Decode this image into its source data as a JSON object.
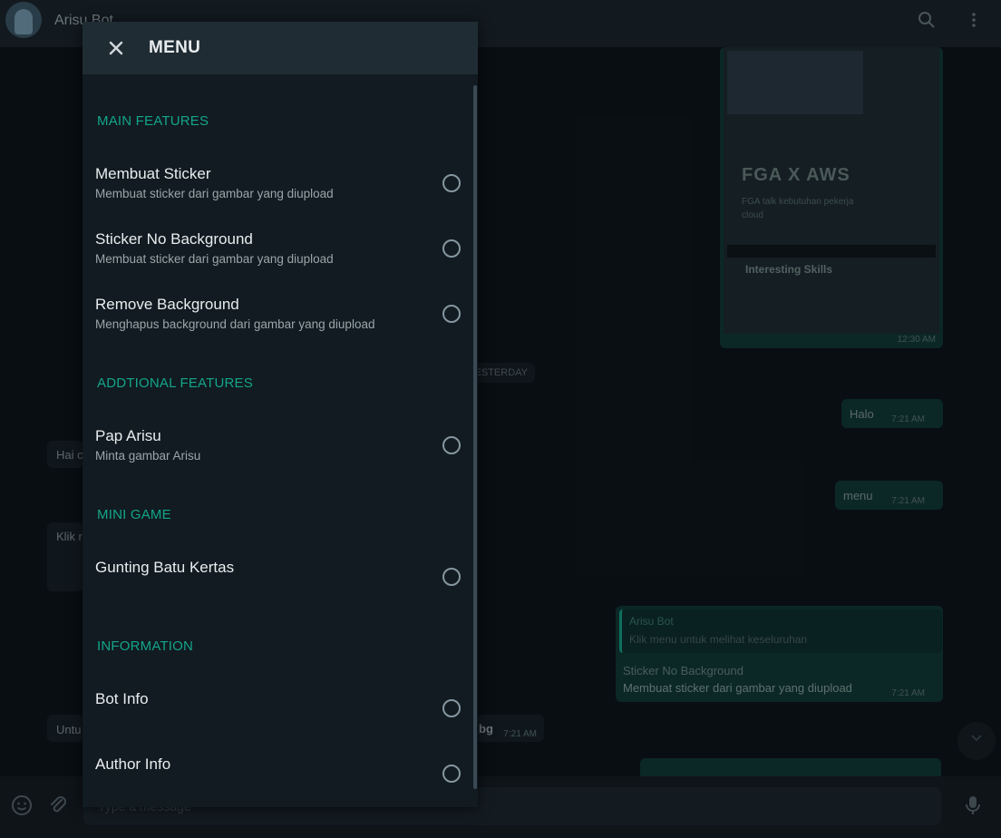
{
  "chat": {
    "title": "Arisu Bot",
    "day_chip": "YESTERDAY",
    "messages": [
      {
        "text": "Halo",
        "time": "7:21 AM"
      },
      {
        "text": "menu",
        "time": "7:21 AM"
      }
    ],
    "media": {
      "title": "FGA X AWS",
      "subtitle": "FGA talk kebutuhan pekerja cloud",
      "skills": "Interesting Skills",
      "time": "12:30 AM"
    },
    "reply": {
      "sender": "Arisu Bot",
      "quoted": "Klik menu untuk melihat keseluruhan",
      "title": "Sticker No Background",
      "desc": "Membuat sticker dari gambar yang diupload",
      "time": "7:21 AM"
    },
    "incoming": [
      {
        "text": "Hai c"
      },
      {
        "text": "Klik r"
      },
      {
        "text": "Untu"
      }
    ],
    "partial_bg_text": "bg",
    "partial_bg_time": "7:21 AM",
    "input_placeholder": "Type a message"
  },
  "menu": {
    "title": "MENU",
    "sections": [
      {
        "heading": "MAIN FEATURES",
        "items": [
          {
            "title": "Membuat Sticker",
            "desc": "Membuat sticker dari gambar yang diupload"
          },
          {
            "title": "Sticker No Background",
            "desc": "Membuat sticker dari gambar yang diupload"
          },
          {
            "title": "Remove Background",
            "desc": "Menghapus background dari gambar yang diupload"
          }
        ]
      },
      {
        "heading": "ADDTIONAL FEATURES",
        "items": [
          {
            "title": "Pap Arisu",
            "desc": "Minta gambar Arisu"
          }
        ]
      },
      {
        "heading": "MINI GAME",
        "items": [
          {
            "title": "Gunting Batu Kertas",
            "desc": ""
          }
        ]
      },
      {
        "heading": "INFORMATION",
        "items": [
          {
            "title": "Bot Info",
            "desc": ""
          },
          {
            "title": "Author Info",
            "desc": ""
          }
        ]
      }
    ]
  },
  "icons": {
    "close": "close-icon",
    "search": "search-icon",
    "more": "more-vertical-icon",
    "emoji": "emoji-icon",
    "attach": "attach-icon",
    "mic": "mic-icon"
  },
  "colors": {
    "accent": "#14a58a",
    "panel": "#111b21",
    "header": "#202c33"
  }
}
